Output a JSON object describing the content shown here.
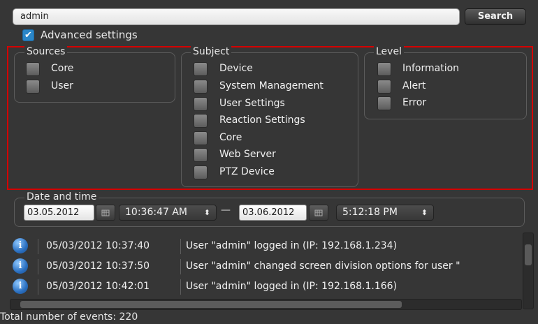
{
  "search": {
    "value": "admin",
    "button_label": "Search"
  },
  "advanced": {
    "label": "Advanced settings",
    "checked": true
  },
  "sources": {
    "title": "Sources",
    "items": [
      "Core",
      "User"
    ]
  },
  "subject": {
    "title": "Subject",
    "items": [
      "Device",
      "System Management",
      "User Settings",
      "Reaction Settings",
      "Core",
      "Web Server",
      "PTZ Device"
    ]
  },
  "level": {
    "title": "Level",
    "items": [
      "Information",
      "Alert",
      "Error"
    ]
  },
  "datetime": {
    "title": "Date and time",
    "from_date": "03.05.2012",
    "from_time": "10:36:47 AM",
    "to_date": "03.06.2012",
    "to_time": "5:12:18 PM",
    "separator": "—",
    "spinner": "⬍"
  },
  "events": [
    {
      "icon": "info-icon",
      "time": "05/03/2012 10:37:40",
      "message": "User \"admin\" logged in (IP: 192.168.1.234)"
    },
    {
      "icon": "info-icon",
      "time": "05/03/2012 10:37:50",
      "message": "User \"admin\" changed screen division options for user \""
    },
    {
      "icon": "info-icon",
      "time": "05/03/2012 10:42:01",
      "message": "User \"admin\" logged in (IP: 192.168.1.166)"
    }
  ],
  "total": "Total number of events: 220",
  "colors": {
    "background": "#363636",
    "accent": "#2a86c8",
    "highlight": "#d40000"
  }
}
